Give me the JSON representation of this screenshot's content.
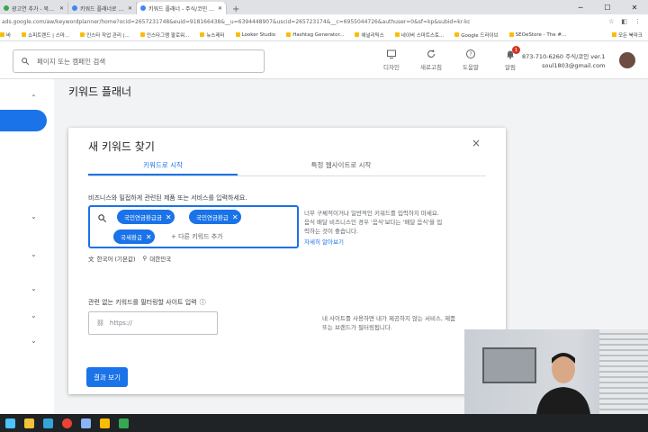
{
  "browser": {
    "tabs": [
      {
        "title": "광고연 추가 - 북새관상 건강",
        "active": false
      },
      {
        "title": "키워드 플래너로 캠페인 키워드",
        "active": false
      },
      {
        "title": "키워드 플래너 - 주식/코인 ver",
        "active": true
      }
    ],
    "new_tab": "+",
    "url": "ads.google.com/aw/keywordplanner/home?ocid=2657231748&euid=918166438&__u=6394448907&uscid=265723174&__c=6955044726&authuser=0&sf=kp&subid=kr-ko-ha-aw-a-bk-a-sb0%21o1~CjOKCQjAggGr...",
    "bookmarks": [
      "바",
      "쇼피트랜드 | 스마...",
      "인스타 작업 관리 |...",
      "인스타그램 팔로워...",
      "뉴스레터",
      "Looker Studio",
      "Hashtag Generator...",
      "애널리틱스",
      "네이버 스마트스토...",
      "Google 드라이브",
      "SEOeStore - The #..."
    ],
    "bookmarks_right": "모든 북마크"
  },
  "header": {
    "search_placeholder": "페이지 또는 캠페인 검색",
    "tools": [
      {
        "label": "디자인",
        "icon": "design-icon"
      },
      {
        "label": "새로고침",
        "icon": "refresh-icon"
      },
      {
        "label": "도움말",
        "icon": "help-icon"
      },
      {
        "label": "알림",
        "icon": "bell-icon",
        "badge": "1"
      }
    ],
    "account_line1": "873-710-6260 주식/코인 ver.1",
    "account_line2": "soul1803@gmail.com"
  },
  "page": {
    "title": "키워드 플래너"
  },
  "dialog": {
    "title": "새 키워드 찾기",
    "close": "×",
    "tabs": [
      {
        "label": "키워드로 시작",
        "active": true
      },
      {
        "label": "특정 웹사이트로 시작",
        "active": false
      }
    ],
    "instruction": "비즈니스와 밀접하게 관련된 제품 또는 서비스를 입력하세요.",
    "chips": [
      "국민연금환급금",
      "국민연금환급",
      "국세환급"
    ],
    "add_keyword": "+ 다른 키워드 추가",
    "tip_line1": "너무 구체적이거나 일반적인 키워드를 입력하지 마세요.",
    "tip_line2": "음식 배달 비즈니스인 경우 '음식'보다는 '배달 음식'을 입",
    "tip_line3": "력하는 것이 좋습니다.",
    "learn_more": "자세히 알아보기",
    "language": "한국어 (기본값)",
    "location": "대한민국",
    "site_label": "관련 없는 키워드를 필터링할 사이트 입력",
    "site_placeholder": "https://",
    "site_tip_line1": "내 사이트를 사용하면 내가 제공하지 않는 서비스, 제품",
    "site_tip_line2": "또는 브랜드가 필터링됩니다.",
    "result_button": "결과 보기"
  },
  "colors": {
    "accent": "#1a73e8",
    "badge": "#d93025"
  }
}
